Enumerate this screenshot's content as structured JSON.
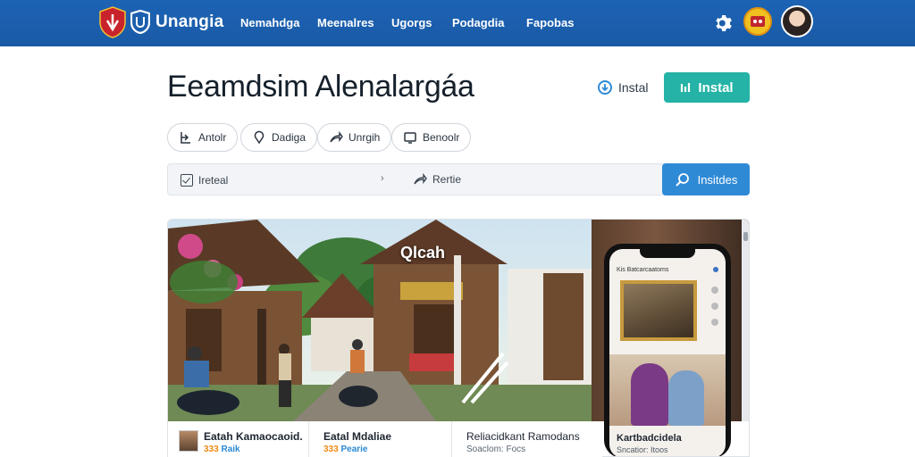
{
  "nav": {
    "brand": "Unangia",
    "items": [
      "Nemahdga",
      "Meenalres",
      "Ugorgs",
      "Podagdia",
      "Fapobas"
    ]
  },
  "header": {
    "title": "Eeamdsim Alenalargáa",
    "install_link": "Instal",
    "install_button": "Instal"
  },
  "filters": {
    "pills": [
      {
        "label": "Antolr",
        "icon": "sort-icon"
      },
      {
        "label": "Dadiga",
        "icon": "location-pin-icon"
      },
      {
        "label": "Unrgih",
        "icon": "share-arrow-icon"
      },
      {
        "label": "Benoolr",
        "icon": "monitor-icon"
      }
    ]
  },
  "search": {
    "field_value": "Ireteal",
    "route_label": "Rertie",
    "button": "Insitdes"
  },
  "hero": {
    "overlay_title": "Qlcah",
    "phone": {
      "top_text": "Kis Batcarcaatoms",
      "caption": "Kartbadcidela",
      "sub": "Sncatior: Itoos"
    }
  },
  "cards": [
    {
      "title": "Eatah Kamaocaoid.",
      "rating": "333",
      "meta": "Raik"
    },
    {
      "title": "Eatal Mdaliae",
      "rating": "333",
      "meta": "Pearie"
    },
    {
      "title": "Reliacidkant Ramodans",
      "rating": "",
      "meta": "Soaclom: Focs"
    }
  ],
  "colors": {
    "nav_bg": "#1d63b4",
    "install_button": "#24b3a6",
    "search_button": "#2f8ad6",
    "rating": "#f08a15",
    "link": "#2c8ad4"
  }
}
